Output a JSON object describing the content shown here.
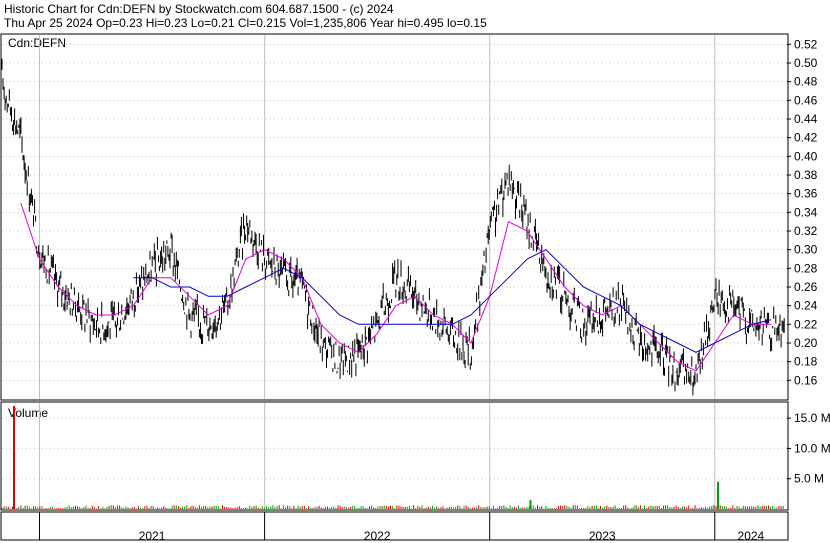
{
  "header": {
    "title": "Historic Chart for Cdn:DEFN by Stockwatch.com 604.687.1500 - (c) 2024",
    "quote": "Thu Apr 25 2024  Op=0.23  Hi=0.23  Lo=0.21  Cl=0.215  Vol=1,235,806  Year hi=0.495  lo=0.15"
  },
  "colors": {
    "price": "#000000",
    "ma_short": "#e000e0",
    "ma_long": "#0000cc",
    "volume_up": "#00a000",
    "volume_down": "#e00000",
    "grid": "#c0c0c0"
  },
  "chart_data": [
    {
      "type": "line",
      "panel_label": "Cdn:DEFN",
      "y_ticks": [
        "0.52",
        "0.50",
        "0.48",
        "0.46",
        "0.44",
        "0.42",
        "0.40",
        "0.38",
        "0.36",
        "0.34",
        "0.32",
        "0.30",
        "0.28",
        "0.26",
        "0.24",
        "0.22",
        "0.20",
        "0.18",
        "0.16"
      ],
      "ylim": [
        0.14,
        0.53
      ],
      "x_labels": [
        "2021",
        "2022",
        "2023",
        "2024"
      ],
      "series": [
        {
          "style": "price",
          "x": [
            "2020-11",
            "2020-12",
            "2021-01",
            "2021-02",
            "2021-03",
            "2021-04",
            "2021-05",
            "2021-06",
            "2021-07",
            "2021-08",
            "2021-09",
            "2021-10",
            "2021-11",
            "2021-12",
            "2022-01",
            "2022-02",
            "2022-03",
            "2022-04",
            "2022-05",
            "2022-06",
            "2022-07",
            "2022-08",
            "2022-09",
            "2022-10",
            "2022-11",
            "2022-12",
            "2023-01",
            "2023-02",
            "2023-03",
            "2023-04",
            "2023-05",
            "2023-06",
            "2023-07",
            "2023-08",
            "2023-09",
            "2023-10",
            "2023-11",
            "2023-12",
            "2024-01",
            "2024-02",
            "2024-03",
            "2024-04"
          ],
          "values": [
            0.48,
            0.42,
            0.3,
            0.26,
            0.24,
            0.22,
            0.22,
            0.25,
            0.28,
            0.3,
            0.23,
            0.22,
            0.24,
            0.33,
            0.29,
            0.27,
            0.26,
            0.2,
            0.18,
            0.19,
            0.22,
            0.27,
            0.25,
            0.23,
            0.21,
            0.19,
            0.32,
            0.38,
            0.33,
            0.28,
            0.25,
            0.22,
            0.23,
            0.24,
            0.2,
            0.19,
            0.17,
            0.16,
            0.25,
            0.24,
            0.22,
            0.215
          ]
        },
        {
          "style": "ma_short",
          "x": [
            "2020-11",
            "2020-12",
            "2021-01",
            "2021-02",
            "2021-03",
            "2021-04",
            "2021-05",
            "2021-06",
            "2021-07",
            "2021-08",
            "2021-09",
            "2021-10",
            "2021-11",
            "2021-12",
            "2022-01",
            "2022-02",
            "2022-03",
            "2022-04",
            "2022-05",
            "2022-06",
            "2022-07",
            "2022-08",
            "2022-09",
            "2022-10",
            "2022-11",
            "2022-12",
            "2023-01",
            "2023-02",
            "2023-03",
            "2023-04",
            "2023-05",
            "2023-06",
            "2023-07",
            "2023-08",
            "2023-09",
            "2023-10",
            "2023-11",
            "2023-12",
            "2024-01",
            "2024-02",
            "2024-03",
            "2024-04"
          ],
          "values": [
            null,
            0.35,
            0.29,
            0.26,
            0.24,
            0.23,
            0.23,
            0.24,
            0.27,
            0.27,
            0.25,
            0.23,
            0.24,
            0.29,
            0.3,
            0.29,
            0.27,
            0.22,
            0.2,
            0.19,
            0.21,
            0.24,
            0.25,
            0.23,
            0.22,
            0.2,
            0.25,
            0.33,
            0.32,
            0.29,
            0.26,
            0.24,
            0.23,
            0.24,
            0.22,
            0.2,
            0.18,
            0.17,
            0.2,
            0.23,
            0.22,
            0.22
          ]
        },
        {
          "style": "ma_long",
          "x": [
            "2021-06",
            "2021-07",
            "2021-08",
            "2021-09",
            "2021-10",
            "2021-11",
            "2021-12",
            "2022-01",
            "2022-02",
            "2022-03",
            "2022-04",
            "2022-05",
            "2022-06",
            "2022-07",
            "2022-08",
            "2022-09",
            "2022-10",
            "2022-11",
            "2022-12",
            "2023-01",
            "2023-02",
            "2023-03",
            "2023-04",
            "2023-05",
            "2023-06",
            "2023-07",
            "2023-08",
            "2023-09",
            "2023-10",
            "2023-11",
            "2023-12",
            "2024-01",
            "2024-02",
            "2024-03",
            "2024-04"
          ],
          "values": [
            0.27,
            0.27,
            0.26,
            0.26,
            0.25,
            0.25,
            0.26,
            0.27,
            0.28,
            0.27,
            0.25,
            0.23,
            0.22,
            0.22,
            0.22,
            0.22,
            0.22,
            0.22,
            0.23,
            0.25,
            0.27,
            0.29,
            0.3,
            0.28,
            0.26,
            0.25,
            0.24,
            0.22,
            0.21,
            0.2,
            0.19,
            0.2,
            0.21,
            0.22,
            0.225
          ]
        }
      ]
    },
    {
      "type": "bar",
      "panel_label": "Volume",
      "y_ticks": [
        "15.0 M",
        "10.0 M",
        "5.0 M"
      ],
      "ylim": [
        0,
        17.5
      ],
      "unit": "M",
      "spikes": [
        {
          "x": "2020-11",
          "value": 17.0,
          "direction": "down"
        },
        {
          "x": "2023-12",
          "value": 4.5,
          "direction": "up"
        },
        {
          "x": "2023-02",
          "value": 1.5,
          "direction": "up"
        }
      ],
      "baseline_typical": 0.4
    }
  ]
}
